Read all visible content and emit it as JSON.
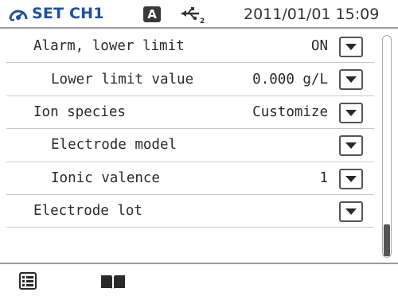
{
  "header": {
    "title": "SET CH1",
    "badge": "A",
    "datetime": "2011/01/01 15:09",
    "icons": [
      "channel-dial-icon",
      "usb-icon"
    ]
  },
  "rows": [
    {
      "label": "Alarm, lower limit",
      "value": "ON"
    },
    {
      "label": "Lower limit value",
      "value": "0.000 g/L"
    },
    {
      "label": "Ion species",
      "value": "Customize"
    },
    {
      "label": "Electrode model",
      "value": ""
    },
    {
      "label": "Ionic valence",
      "value": "1"
    },
    {
      "label": "Electrode lot",
      "value": ""
    }
  ],
  "footer": {
    "icons": [
      "menu-list-icon",
      "manual-book-icon"
    ]
  },
  "colors": {
    "title": "#1f4fa0",
    "text": "#2a2a2a",
    "divider": "#c8c8c8"
  }
}
